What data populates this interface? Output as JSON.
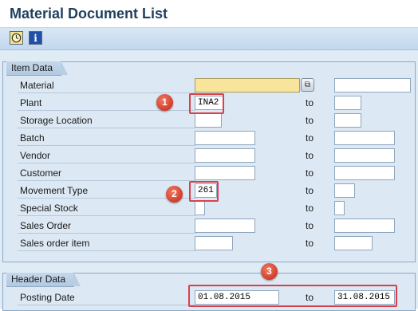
{
  "header": {
    "title": "Material Document List"
  },
  "toolbar": {
    "execute_icon": "execute-clock-icon",
    "info_icon": "info-icon",
    "info_glyph": "i"
  },
  "item_data": {
    "title": "Item Data",
    "to_label": "to",
    "rows": [
      {
        "label": "Material",
        "from": "",
        "to": ""
      },
      {
        "label": "Plant",
        "from": "INA2",
        "to": ""
      },
      {
        "label": "Storage Location",
        "from": "",
        "to": ""
      },
      {
        "label": "Batch",
        "from": "",
        "to": ""
      },
      {
        "label": "Vendor",
        "from": "",
        "to": ""
      },
      {
        "label": "Customer",
        "from": "",
        "to": ""
      },
      {
        "label": "Movement Type",
        "from": "261",
        "to": ""
      },
      {
        "label": "Special Stock",
        "from": "",
        "to": ""
      },
      {
        "label": "Sales Order",
        "from": "",
        "to": ""
      },
      {
        "label": "Sales order item",
        "from": "",
        "to": ""
      }
    ]
  },
  "header_data": {
    "title": "Header Data",
    "to_label": "to",
    "rows": [
      {
        "label": "Posting Date",
        "from": "01.08.2015",
        "to": "31.08.2015"
      }
    ]
  },
  "annotations": {
    "badge1": "1",
    "badge2": "2",
    "badge3": "3"
  },
  "colors": {
    "highlight": "#d9414a",
    "required_field": "#f8e49a",
    "title": "#1f3f5f"
  }
}
